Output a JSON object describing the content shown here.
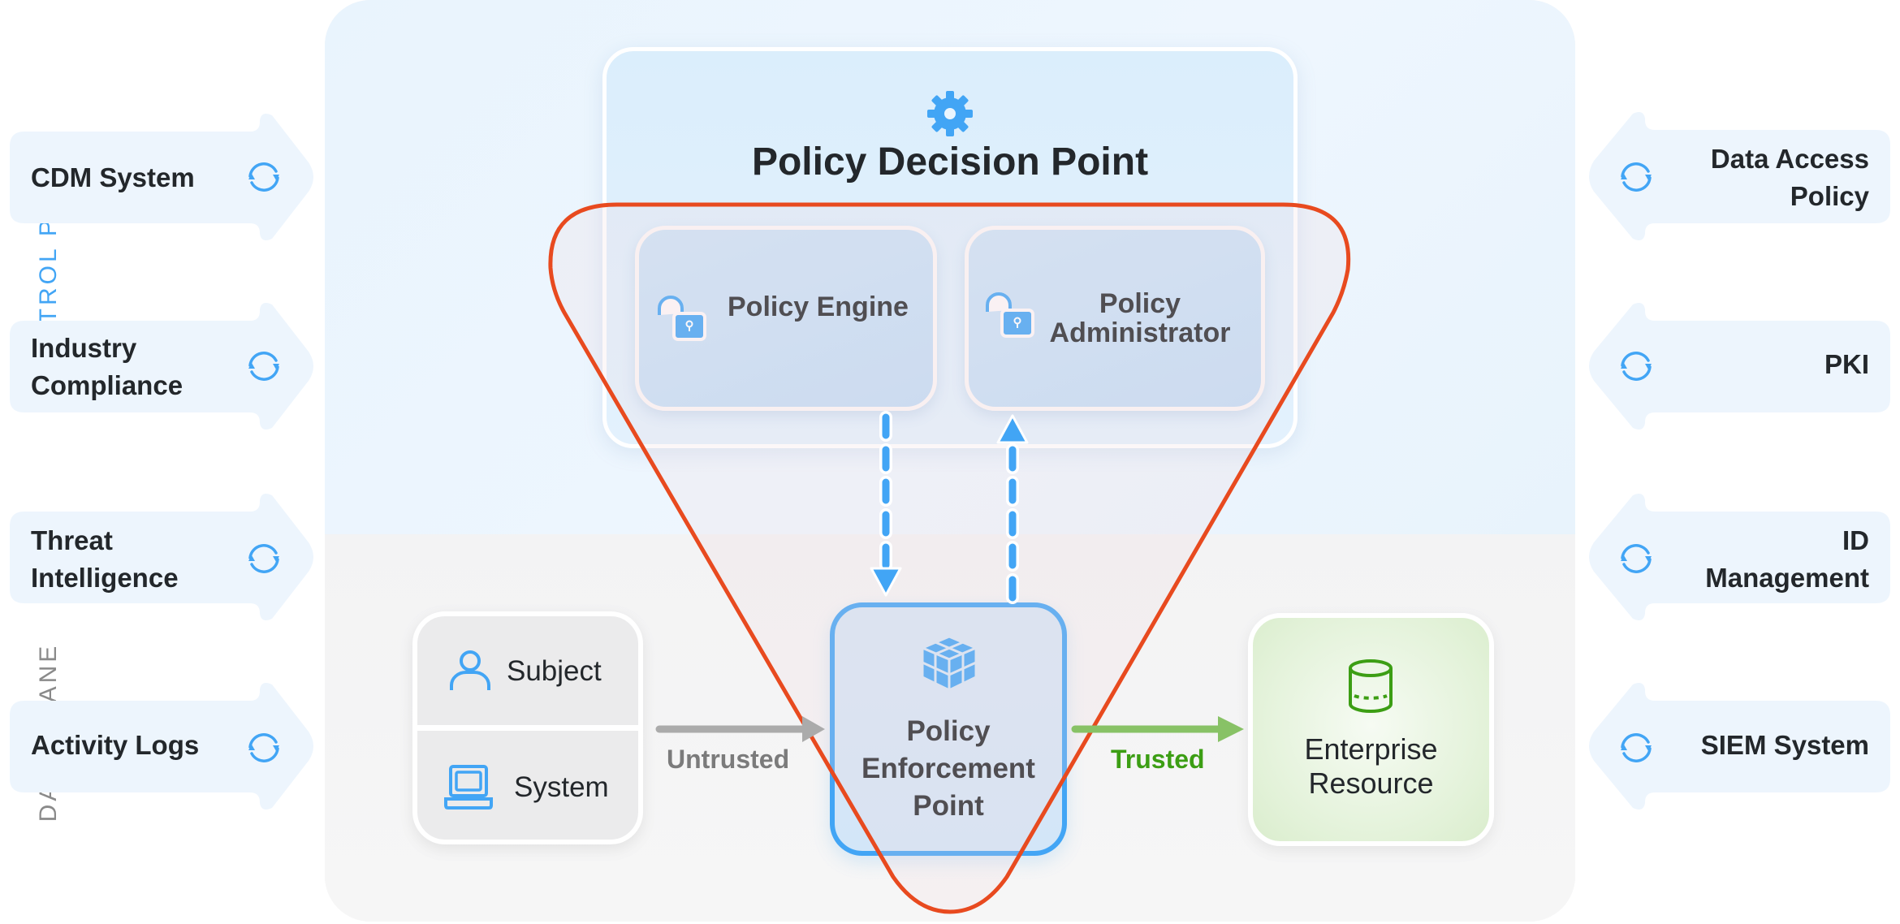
{
  "diagram": {
    "planes": {
      "control": "CONTROL PLANE",
      "data": "DATA PLANE"
    },
    "pdp": {
      "title": "Policy Decision Point",
      "icon": "gear-icon",
      "components": [
        {
          "label": "Policy Engine",
          "icon": "unlock-icon"
        },
        {
          "label_line1": "Policy",
          "label_line2": "Administrator",
          "icon": "unlock-icon"
        }
      ]
    },
    "actors": {
      "subject": {
        "label": "Subject",
        "icon": "user-icon"
      },
      "system": {
        "label": "System",
        "icon": "laptop-icon"
      }
    },
    "pep": {
      "line1": "Policy",
      "line2": "Enforcement",
      "line3": "Point",
      "icon": "cube-icon"
    },
    "resource": {
      "line1": "Enterprise",
      "line2": "Resource",
      "icon": "database-icon"
    },
    "flows": {
      "untrusted": "Untrusted",
      "trusted": "Trusted"
    },
    "left_inputs": [
      {
        "line1": "CDM System",
        "line2": ""
      },
      {
        "line1": "Industry",
        "line2": "Compliance"
      },
      {
        "line1": "Threat",
        "line2": "Intelligence"
      },
      {
        "line1": "Activity Logs",
        "line2": ""
      }
    ],
    "right_inputs": [
      {
        "line1": "Data Access",
        "line2": "Policy"
      },
      {
        "line1": "PKI",
        "line2": ""
      },
      {
        "line1": "ID",
        "line2": "Management"
      },
      {
        "line1": "SIEM System",
        "line2": ""
      }
    ],
    "colors": {
      "accent_blue": "#42a5f5",
      "trust_zone_red": "#e84a1f",
      "trusted_green": "#3c9e14",
      "untrusted_gray": "#9e9e9e",
      "input_fill": "#edf5fd"
    }
  }
}
